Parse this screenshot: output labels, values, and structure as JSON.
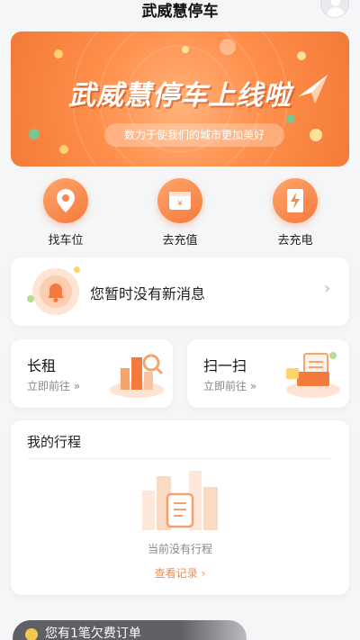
{
  "header": {
    "title": "武威慧停车"
  },
  "banner": {
    "headline": "武威慧停车上线啦",
    "subtitle": "数力于使我们的城市更加美好"
  },
  "quick_actions": [
    {
      "label": "找车位",
      "icon": "location-pin-icon"
    },
    {
      "label": "去充值",
      "icon": "wallet-icon"
    },
    {
      "label": "去充电",
      "icon": "charging-icon"
    }
  ],
  "message": {
    "text": "您暂时没有新消息",
    "icon": "bell-icon"
  },
  "long_rent": {
    "title": "长租",
    "link": "立即前往"
  },
  "scan": {
    "title": "扫一扫",
    "link": "立即前往"
  },
  "trips": {
    "title": "我的行程",
    "empty_text": "当前没有行程",
    "records_link": "查看记录"
  },
  "toast": {
    "text": "您有1笔欠费订单"
  },
  "colors": {
    "accent": "#f57a3d",
    "link": "#f38a4a"
  }
}
